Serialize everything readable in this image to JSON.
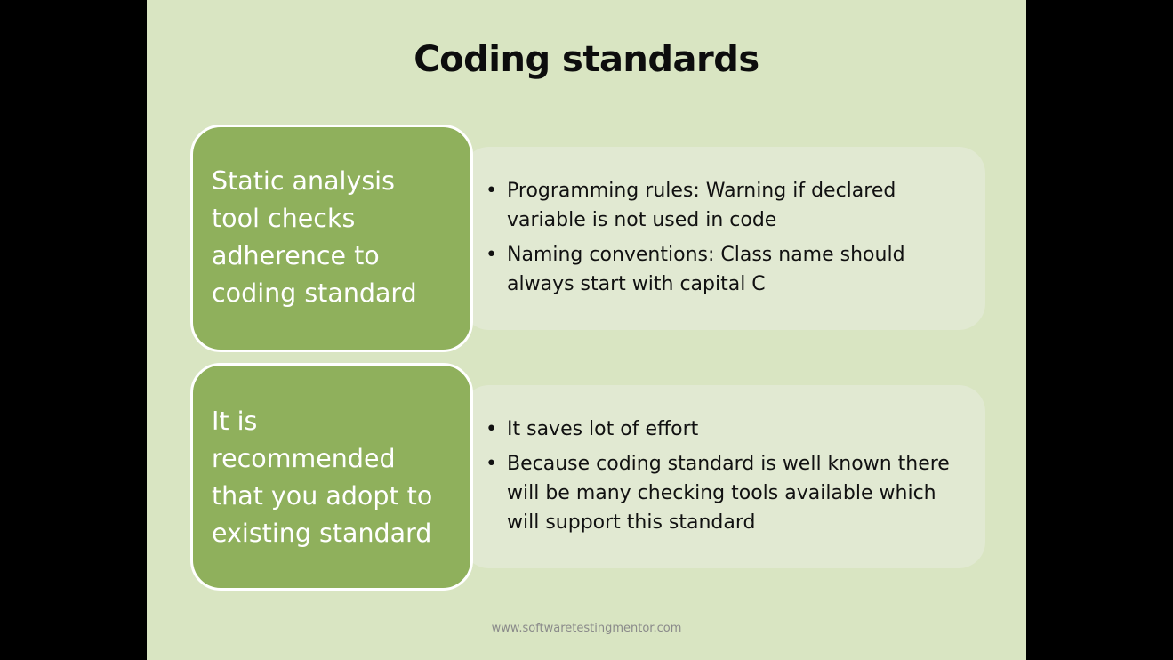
{
  "slide": {
    "title": "Coding standards",
    "footer": "www.softwaretestingmentor.com",
    "sections": [
      {
        "heading": "Static analysis\ntool checks\nadherence to\ncoding standard",
        "bullets": [
          "Programming rules: Warning if declared variable is not used in code",
          "Naming conventions: Class name should always start with capital C"
        ]
      },
      {
        "heading": "It is\nrecommended\nthat you adopt to\nexisting standard",
        "bullets": [
          "It saves lot of effort",
          "Because coding standard is well known there will be many checking tools available which will support this standard"
        ]
      }
    ]
  },
  "colors": {
    "slide_background": "#d9e5c2",
    "heading_box": "#8fb05c",
    "detail_box": "#e1e9d2"
  }
}
